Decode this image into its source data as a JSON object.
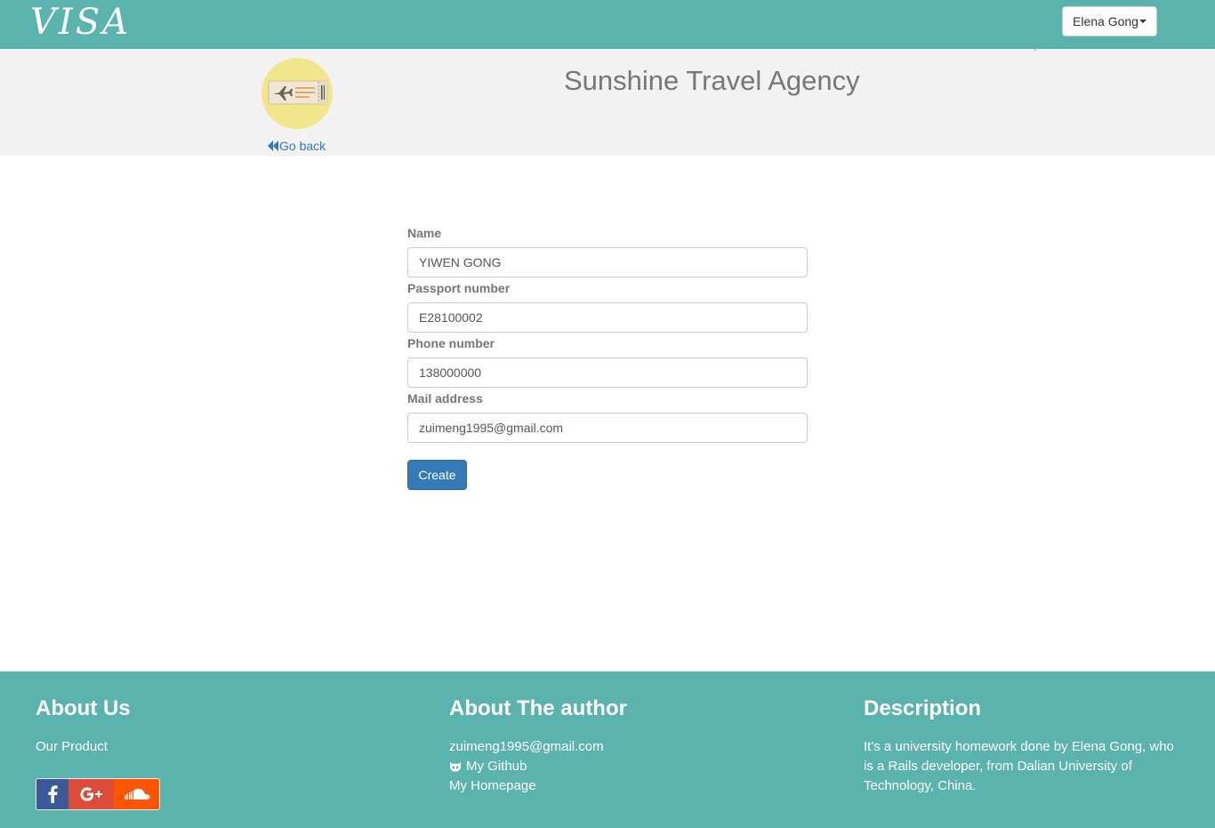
{
  "navbar": {
    "logo": "VISA",
    "user_menu": "Elena Gong",
    "caret_icon": "caret-down-icon"
  },
  "header": {
    "title": "Sunshine Travel Agency",
    "go_back": "Go back",
    "logo_icon": "plane-ticket-icon",
    "back_icon": "fast-backward-icon",
    "tick": "`"
  },
  "form": {
    "fields": [
      {
        "label": "Name",
        "value": "YIWEN GONG"
      },
      {
        "label": "Passport number",
        "value": "E28100002"
      },
      {
        "label": "Phone number",
        "value": "138000000"
      },
      {
        "label": "Mail address",
        "value": "zuimeng1995@gmail.com"
      }
    ],
    "submit": "Create"
  },
  "footer": {
    "about_us": {
      "title": "About Us",
      "product": "Our Product"
    },
    "author": {
      "title": "About The author",
      "email": "zuimeng1995@gmail.com",
      "github": "My Github",
      "homepage": "My Homepage"
    },
    "description": {
      "title": "Description",
      "text": "It's a university homework done by Elena Gong, who is a Rails developer, from Dalian University of Technology, China."
    },
    "social": [
      "facebook-icon",
      "google-plus-icon",
      "soundcloud-icon"
    ]
  },
  "colors": {
    "navbar": "#5bb3ad",
    "header_bg": "#f2f2f2",
    "primary": "#337ab7",
    "facebook": "#3b5998",
    "google": "#dd4b39",
    "soundcloud": "#ff5500"
  }
}
